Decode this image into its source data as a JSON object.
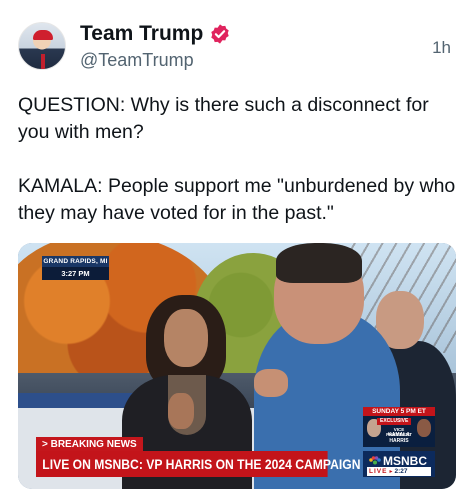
{
  "author": {
    "name": "Team Trump",
    "handle": "@TeamTrump",
    "verified_badge_icon": "verified-badge-icon",
    "verified_color": "#e0245e"
  },
  "post": {
    "time": "1h",
    "paragraphs": [
      "QUESTION: Why is there such a disconnect for you with men?",
      "KAMALA: People support me \"unburdened by who they may have voted for in the past.\""
    ]
  },
  "video": {
    "location": "GRAND RAPIDS, MI",
    "location_time": "3:27 PM",
    "breaking_label": "> BREAKING NEWS",
    "banner_text": "LIVE ON MSNBC: VP HARRIS ON THE 2024 CAMPAIGN",
    "promo_day": "SUNDAY 5 PM ET",
    "promo_tag": "EXCLUSIVE",
    "promo_title_line1": "VICE PRESIDENT",
    "promo_title_line2": "KAMALA HARRIS",
    "network_logo": "MSNBC",
    "live_label": "LIVE",
    "live_arrow": "▸",
    "live_time": "2:27",
    "banner_color": "#c3141a",
    "network_color": "#0c2a5c"
  }
}
